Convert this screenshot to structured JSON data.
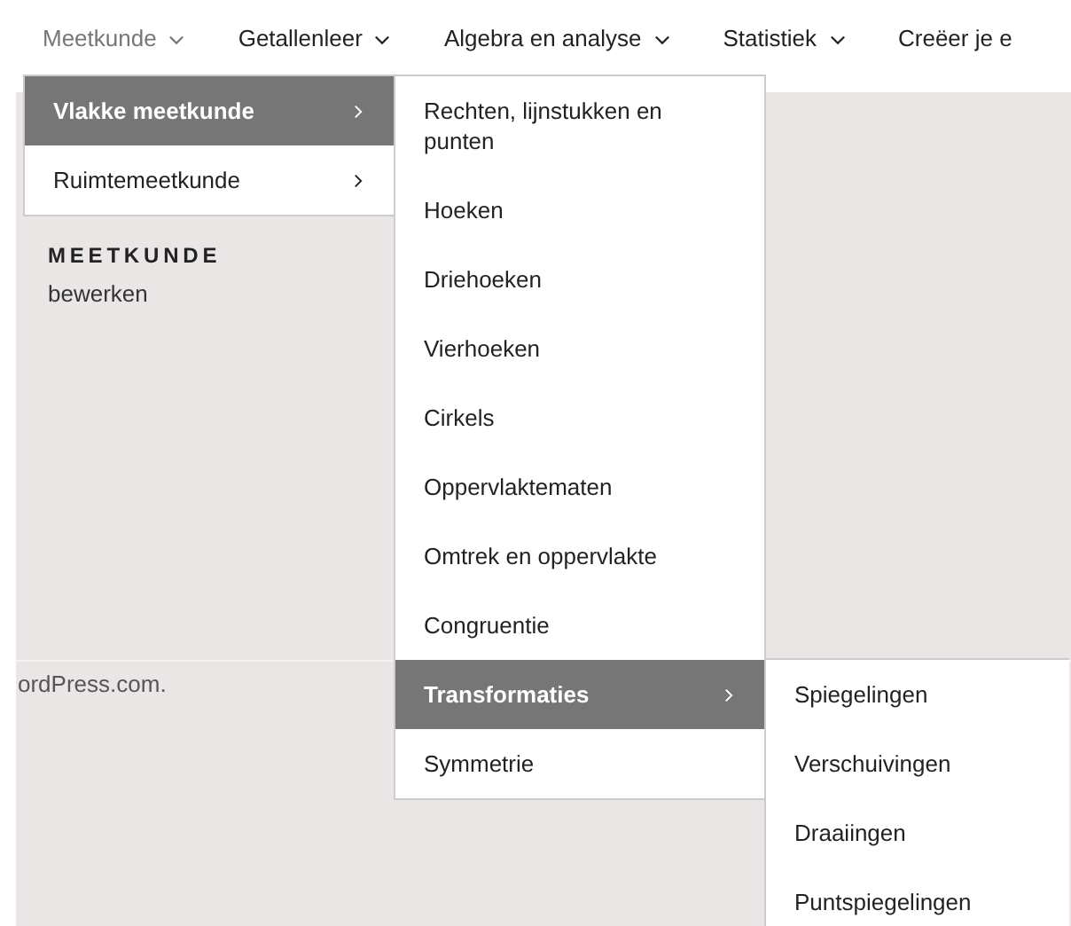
{
  "nav": {
    "items": [
      {
        "label": "Meetkunde",
        "expanded": true,
        "has_submenu": true,
        "children": [
          {
            "label": "Vlakke meetkunde",
            "selected": true,
            "has_submenu": true,
            "children": [
              {
                "label": "Rechten, lijnstukken en punten",
                "selected": false
              },
              {
                "label": "Hoeken",
                "selected": false
              },
              {
                "label": "Driehoeken",
                "selected": false
              },
              {
                "label": "Vierhoeken",
                "selected": false
              },
              {
                "label": "Cirkels",
                "selected": false
              },
              {
                "label": "Oppervlaktematen",
                "selected": false
              },
              {
                "label": "Omtrek en oppervlakte",
                "selected": false
              },
              {
                "label": "Congruentie",
                "selected": false
              },
              {
                "label": "Transformaties",
                "selected": true,
                "has_submenu": true,
                "children": [
                  {
                    "label": "Spiegelingen",
                    "selected": false
                  },
                  {
                    "label": "Verschuivingen",
                    "selected": false
                  },
                  {
                    "label": "Draaiingen",
                    "selected": false
                  },
                  {
                    "label": "Puntspiegelingen",
                    "selected": false
                  }
                ]
              },
              {
                "label": "Symmetrie",
                "selected": false
              }
            ]
          },
          {
            "label": "Ruimtemeetkunde",
            "selected": false,
            "has_submenu": true
          }
        ]
      },
      {
        "label": "Getallenleer",
        "expanded": false,
        "has_submenu": true
      },
      {
        "label": "Algebra en analyse",
        "expanded": false,
        "has_submenu": true
      },
      {
        "label": "Statistiek",
        "expanded": false,
        "has_submenu": true
      },
      {
        "label": "Creëer je e",
        "expanded": false
      }
    ]
  },
  "content": {
    "heading": "MEETKUNDE",
    "edit_link": "bewerken"
  },
  "footer": {
    "text": "ordPress.com."
  }
}
